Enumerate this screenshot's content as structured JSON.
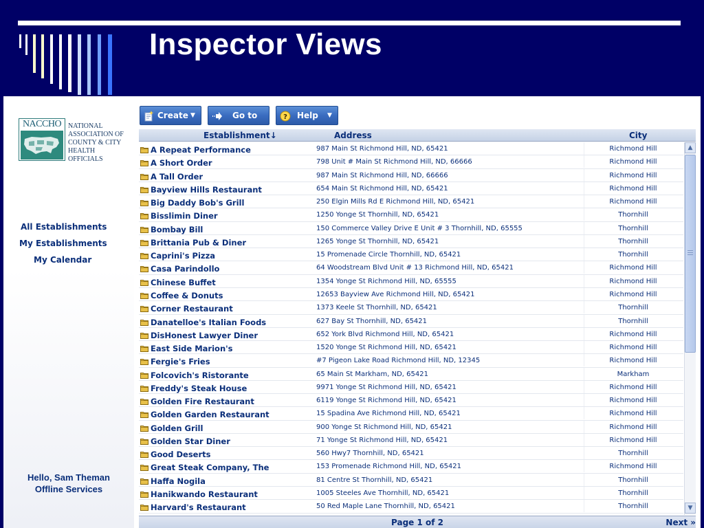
{
  "slide": {
    "title": "Inspector Views"
  },
  "logo": {
    "acronym": "NACCHO",
    "line1": "NATIONAL",
    "line2": "ASSOCIATION OF",
    "line3": "COUNTY & CITY",
    "line4": "HEALTH OFFICIALS"
  },
  "nav": {
    "all_establishments": "All Establishments",
    "my_establishments": "My Establishments",
    "my_calendar": "My Calendar"
  },
  "user": {
    "greeting": "Hello, Sam Theman",
    "status": "Offline Services"
  },
  "toolbar": {
    "create_label": "Create",
    "goto_label": "Go to",
    "help_label": "Help"
  },
  "grid": {
    "columns": {
      "establishment": "Establishment",
      "address": "Address",
      "city": "City"
    },
    "sort_indicator": "↓",
    "rows": [
      {
        "name": "A Repeat Performance",
        "address": "987 Main St Richmond Hill, ND, 65421",
        "city": "Richmond Hill"
      },
      {
        "name": "A Short Order",
        "address": "798 Unit # Main St Richmond Hill, ND, 66666",
        "city": "Richmond Hill"
      },
      {
        "name": "A Tall Order",
        "address": "987 Main St Richmond Hill, ND, 66666",
        "city": "Richmond Hill"
      },
      {
        "name": "Bayview Hills Restaurant",
        "address": "654 Main St Richmond Hill, ND, 65421",
        "city": "Richmond Hill"
      },
      {
        "name": "Big Daddy Bob's Grill",
        "address": "250 Elgin Mills Rd E Richmond Hill, ND, 65421",
        "city": "Richmond Hill"
      },
      {
        "name": "Bisslimin Diner",
        "address": "1250 Yonge St Thornhill, ND, 65421",
        "city": "Thornhill"
      },
      {
        "name": "Bombay Bill",
        "address": "150 Commerce Valley Drive E Unit # 3 Thornhill, ND, 65555",
        "city": "Thornhill"
      },
      {
        "name": "Brittania Pub & Diner",
        "address": "1265 Yonge St Thornhill, ND, 65421",
        "city": "Thornhill"
      },
      {
        "name": "Caprini's Pizza",
        "address": "15 Promenade Circle Thornhill, ND, 65421",
        "city": "Thornhill"
      },
      {
        "name": "Casa Parindollo",
        "address": "64 Woodstream Blvd Unit # 13 Richmond Hill, ND, 65421",
        "city": "Richmond Hill"
      },
      {
        "name": "Chinese Buffet",
        "address": "1354 Yonge St Richmond Hill, ND, 65555",
        "city": "Richmond Hill"
      },
      {
        "name": "Coffee & Donuts",
        "address": "12653 Bayview Ave Richmond Hill, ND, 65421",
        "city": "Richmond Hill"
      },
      {
        "name": "Corner Restaurant",
        "address": "1373 Keele St Thornhill, ND, 65421",
        "city": "Thornhill"
      },
      {
        "name": "Danatelloe's Italian Foods",
        "address": "627 Bay St Thornhill, ND, 65421",
        "city": "Thornhill"
      },
      {
        "name": "DisHonest Lawyer Diner",
        "address": "652 York Blvd Richmond Hill, ND, 65421",
        "city": "Richmond Hill"
      },
      {
        "name": "East Side Marion's",
        "address": "1520 Yonge St Richmond Hill, ND, 65421",
        "city": "Richmond Hill"
      },
      {
        "name": "Fergie's Fries",
        "address": "#7 Pigeon Lake Road Richmond Hill, ND, 12345",
        "city": "Richmond Hill"
      },
      {
        "name": "Folcovich's Ristorante",
        "address": "65 Main St Markham, ND, 65421",
        "city": "Markham"
      },
      {
        "name": "Freddy's Steak House",
        "address": "9971 Yonge St Richmond Hill, ND, 65421",
        "city": "Richmond Hill"
      },
      {
        "name": "Golden Fire Restaurant",
        "address": "6119 Yonge St Richmond Hill, ND, 65421",
        "city": "Richmond Hill"
      },
      {
        "name": "Golden Garden Restaurant",
        "address": "15 Spadina Ave Richmond Hill, ND, 65421",
        "city": "Richmond Hill"
      },
      {
        "name": "Golden Grill",
        "address": "900 Yonge St Richmond Hill, ND, 65421",
        "city": "Richmond Hill"
      },
      {
        "name": "Golden Star Diner",
        "address": "71 Yonge St Richmond Hill, ND, 65421",
        "city": "Richmond Hill"
      },
      {
        "name": "Good Deserts",
        "address": "560 Hwy7 Thornhill, ND, 65421",
        "city": "Thornhill"
      },
      {
        "name": "Great Steak Company, The",
        "address": "153 Promenade Richmond Hill, ND, 65421",
        "city": "Richmond Hill"
      },
      {
        "name": "Haffa Nogila",
        "address": "81 Centre St Thornhill, ND, 65421",
        "city": "Thornhill"
      },
      {
        "name": "Hanikwando Restaurant",
        "address": "1005 Steeles Ave Thornhill, ND, 65421",
        "city": "Thornhill"
      },
      {
        "name": "Harvard's Restaurant",
        "address": "50 Red Maple Lane Thornhill, ND, 65421",
        "city": "Thornhill"
      }
    ]
  },
  "pager": {
    "page_text": "Page 1 of 2",
    "next_label": "Next »"
  },
  "icons": {
    "folder": "folder-icon",
    "create": "new-document-icon",
    "goto": "arrow-right-icon",
    "help": "question-icon"
  },
  "colors": {
    "slide_background": "#000066",
    "link_text": "#0b2f7a",
    "toolbar_button": "#3a6cc0",
    "folder": "#e8c14a"
  }
}
